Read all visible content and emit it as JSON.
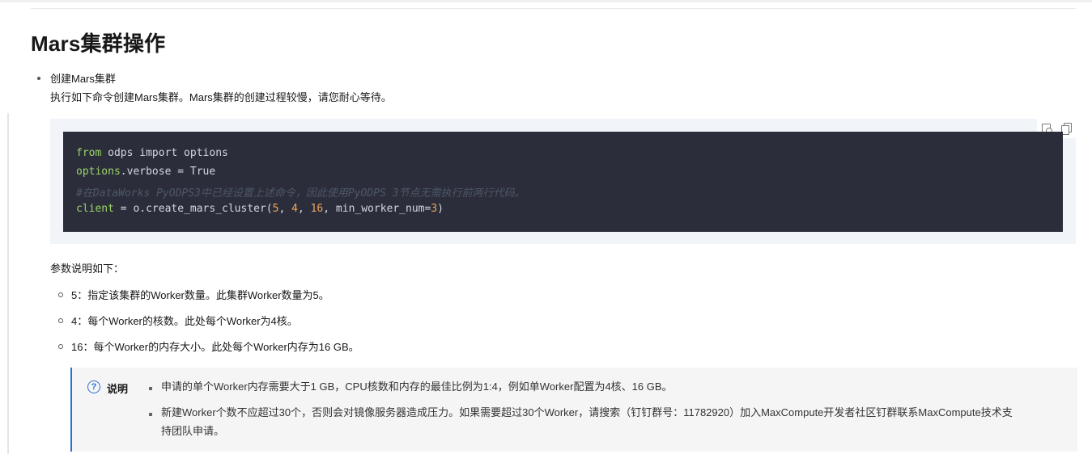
{
  "section": {
    "title": "Mars集群操作",
    "item": {
      "title": "创建Mars集群",
      "description": "执行如下命令创建Mars集群。Mars集群的创建过程较慢，请您耐心等待。"
    }
  },
  "code": {
    "line1": {
      "kw": "from",
      "rest": " odps import options"
    },
    "line2": {
      "kw": "options",
      "rest": ".verbose = True"
    },
    "line3": "#在DataWorks PyODPS3中已经设置上述命令，因此使用PyODPS 3节点无需执行前两行代码。",
    "line4": {
      "kw": "client",
      "rest1": " = o.create_mars_cluster(",
      "n1": "5",
      "sep1": ", ",
      "n2": "4",
      "sep2": ", ",
      "n3": "16",
      "rest2": ", min_worker_num=",
      "n4": "3",
      "rest3": ")"
    },
    "tools": [
      "feedback-icon",
      "copy-icon"
    ]
  },
  "params": {
    "intro": "参数说明如下：",
    "items": [
      "5：指定该集群的Worker数量。此集群Worker数量为5。",
      "4：每个Worker的核数。此处每个Worker为4核。",
      "16：每个Worker的内存大小。此处每个Worker内存为16 GB。"
    ]
  },
  "note": {
    "label": "说明",
    "icon": "?",
    "items": [
      "申请的单个Worker内存需要大于1 GB，CPU核数和内存的最佳比例为1:4，例如单Worker配置为4核、16 GB。",
      "新建Worker个数不应超过30个，否则会对镜像服务器造成压力。如果需要超过30个Worker，请搜索（钉钉群号：11782920）加入MaxCompute开发者社区钉群联系MaxCompute技术支持团队申请。"
    ],
    "accent_color": "#2b6fd6"
  },
  "colors": {
    "code_bg": "#2b2e3a",
    "keyword": "#9ad36a",
    "number": "#f0a35e",
    "comment": "#4f5668"
  }
}
